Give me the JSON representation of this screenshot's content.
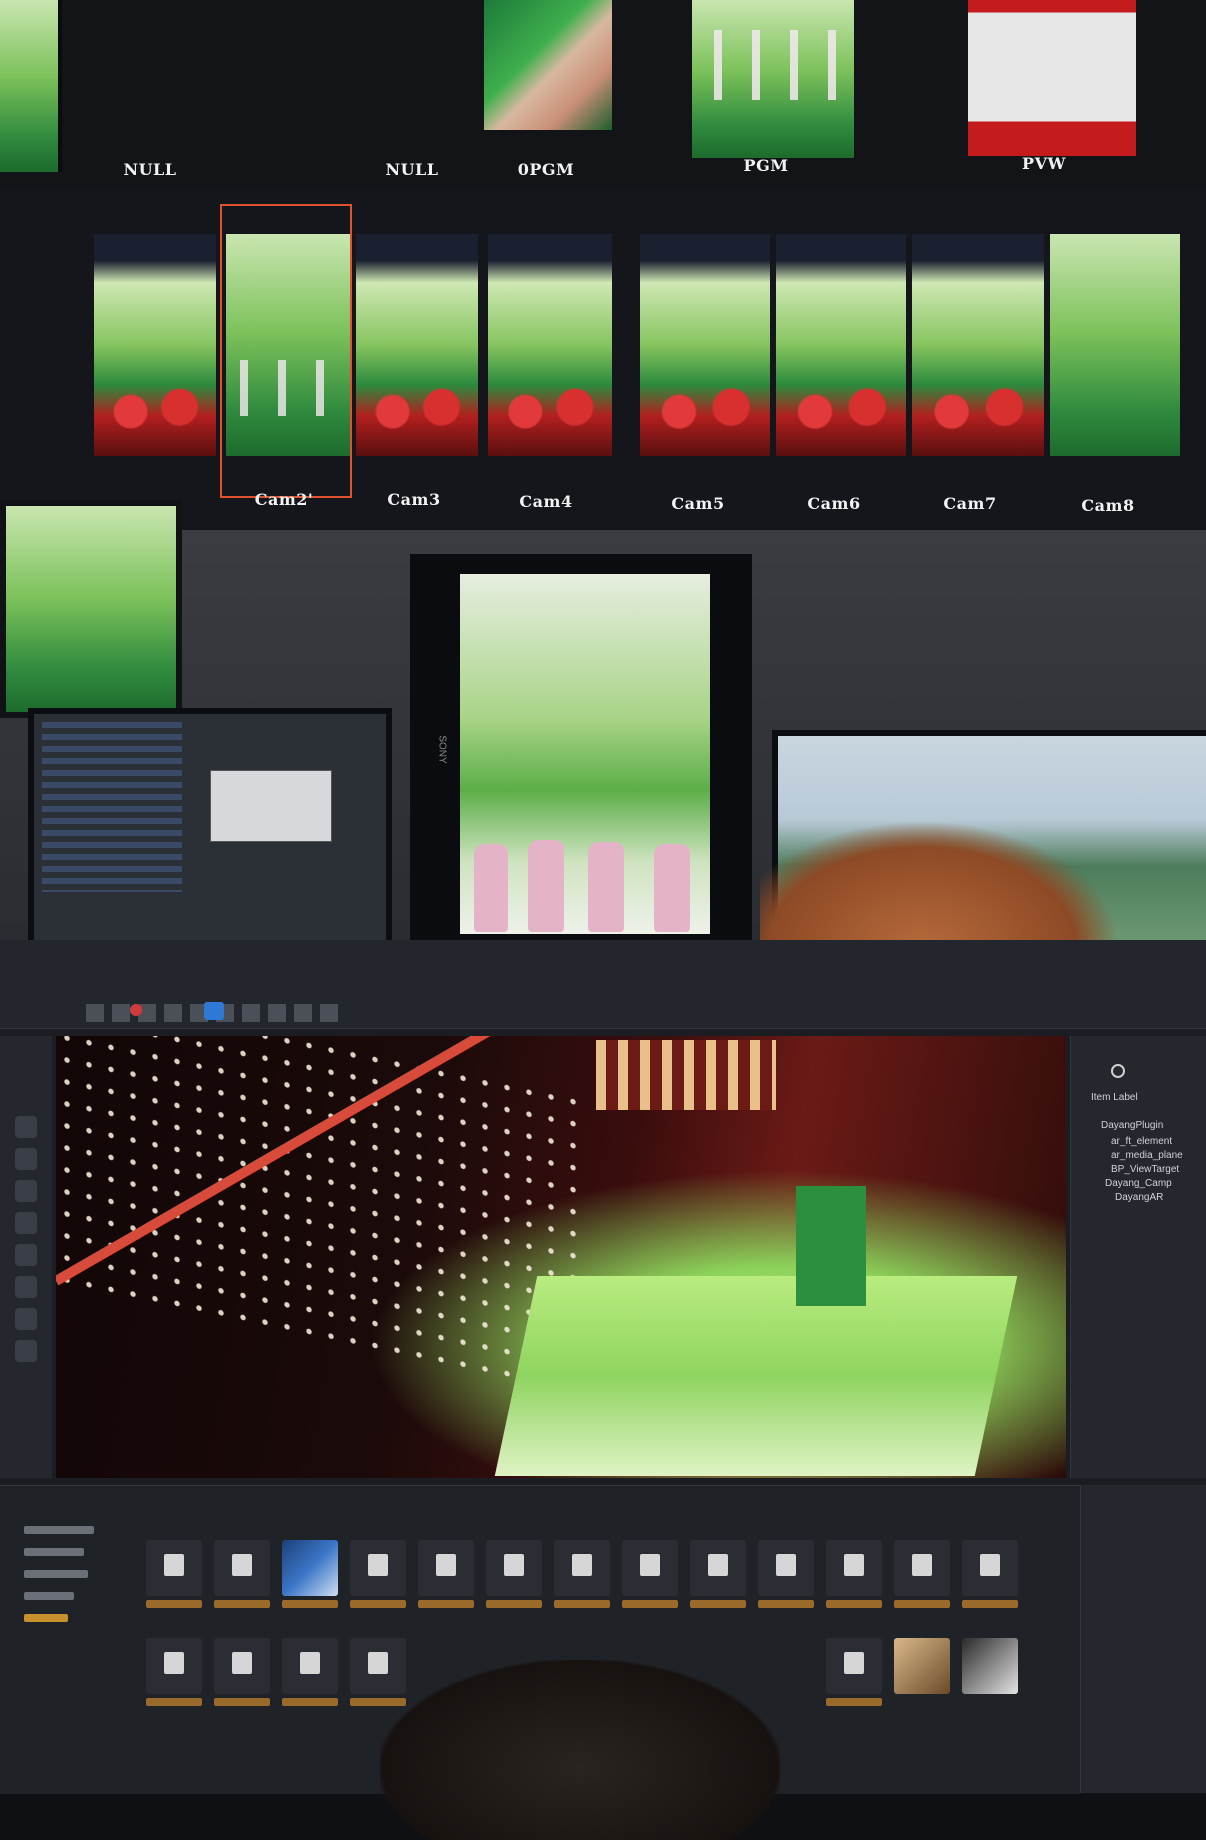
{
  "wall_top": {
    "labels": [
      "NULL",
      "NULL",
      "0PGM",
      "PGM",
      "PVW"
    ]
  },
  "wall_mid": {
    "cameras": [
      "Cam2'",
      "Cam3",
      "Cam4",
      "Cam5",
      "Cam6",
      "Cam7",
      "Cam8"
    ]
  },
  "center_monitor": {
    "brand": "SONY"
  },
  "editor": {
    "outliner_header": "Item Label",
    "outliner_items": [
      "DayangPlugin",
      "ar_ft_element",
      "ar_media_plane",
      "BP_ViewTarget",
      "Dayang_Camp",
      "DayangAR"
    ]
  },
  "colors": {
    "accent_selection": "#e0522e",
    "stage_green": "#7cc15a",
    "stage_red": "#c41c1c"
  }
}
